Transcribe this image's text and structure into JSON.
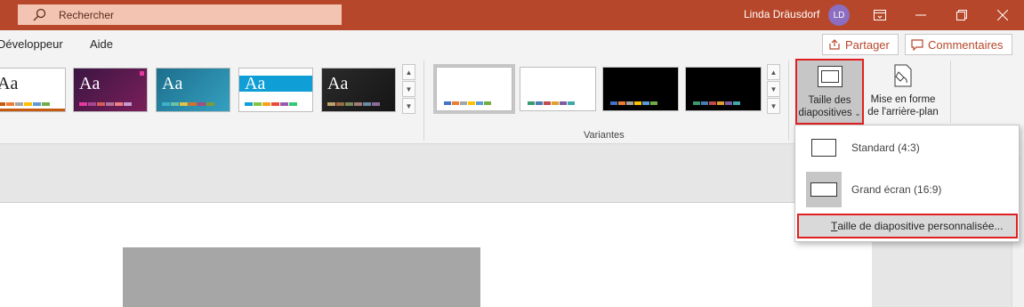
{
  "titlebar": {
    "search_placeholder": "Rechercher",
    "user_name": "Linda Dräusdorf",
    "user_initials": "LD"
  },
  "tabs": [
    {
      "label": "Développeur"
    },
    {
      "label": "Aide"
    }
  ],
  "share_label": "Partager",
  "comments_label": "Commentaires",
  "themes": [
    {
      "name": "white",
      "text": "Aa"
    },
    {
      "name": "purple",
      "text": "Aa"
    },
    {
      "name": "teal",
      "text": "Aa"
    },
    {
      "name": "blue",
      "text": "Aa"
    },
    {
      "name": "dark",
      "text": "Aa"
    }
  ],
  "variants_label": "Variantes",
  "slide_size_button": {
    "line1": "Taille des",
    "line2": "diapositives"
  },
  "bg_format_button": {
    "line1": "Mise en forme",
    "line2": "de l'arrière-plan"
  },
  "menu": {
    "standard": "Standard (4:3)",
    "widescreen": "Grand écran (16:9)",
    "custom_first": "T",
    "custom_rest": "aille de diapositive personnalisée..."
  },
  "colors": {
    "titlebar": "#b7472a",
    "accent": "#b7472a",
    "highlight_border": "#e02020"
  }
}
